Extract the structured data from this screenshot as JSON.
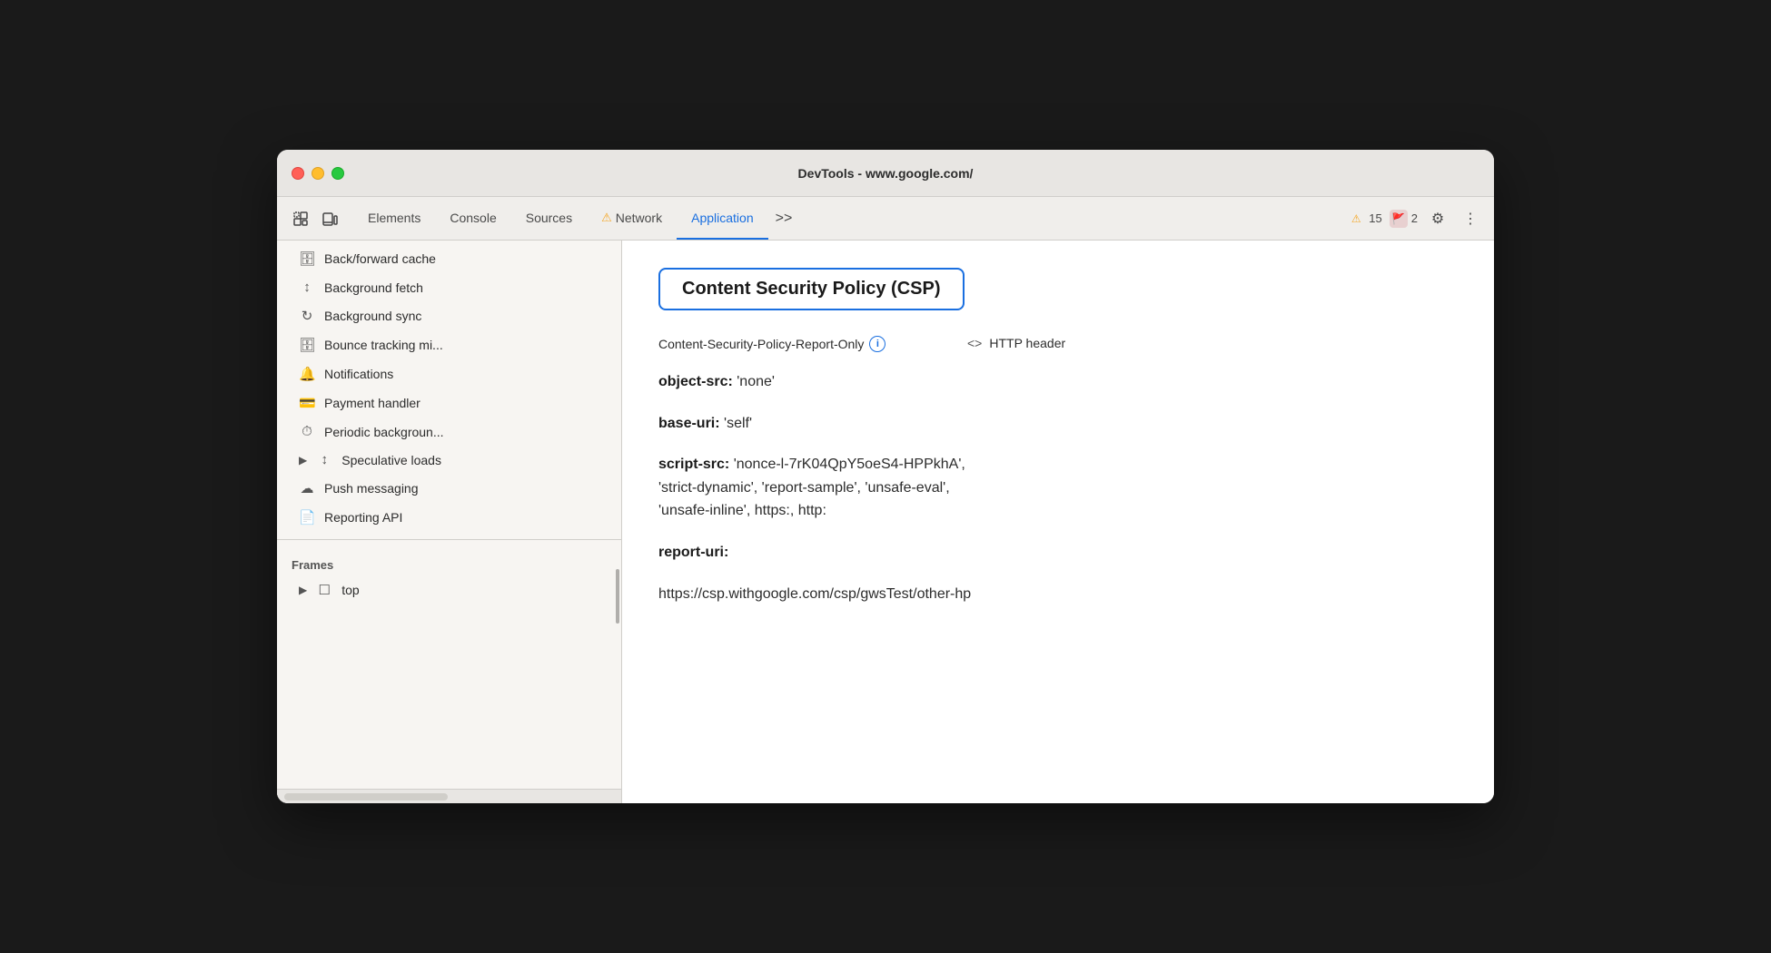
{
  "window": {
    "title": "DevTools - www.google.com/"
  },
  "titlebar": {
    "title": "DevTools - www.google.com/"
  },
  "tabs": [
    {
      "id": "elements",
      "label": "Elements",
      "active": false,
      "warning": false
    },
    {
      "id": "console",
      "label": "Console",
      "active": false,
      "warning": false
    },
    {
      "id": "sources",
      "label": "Sources",
      "active": false,
      "warning": false
    },
    {
      "id": "network",
      "label": "Network",
      "active": false,
      "warning": true
    },
    {
      "id": "application",
      "label": "Application",
      "active": true,
      "warning": false
    }
  ],
  "toolbar": {
    "more_label": ">>",
    "warnings_count": "15",
    "errors_count": "2"
  },
  "sidebar": {
    "items": [
      {
        "id": "back-forward-cache",
        "icon": "🗄",
        "label": "Back/forward cache"
      },
      {
        "id": "background-fetch",
        "icon": "↕",
        "label": "Background fetch"
      },
      {
        "id": "background-sync",
        "icon": "↻",
        "label": "Background sync"
      },
      {
        "id": "bounce-tracking",
        "icon": "🗄",
        "label": "Bounce tracking mi..."
      },
      {
        "id": "notifications",
        "icon": "🔔",
        "label": "Notifications"
      },
      {
        "id": "payment-handler",
        "icon": "💳",
        "label": "Payment handler"
      },
      {
        "id": "periodic-background",
        "icon": "⏱",
        "label": "Periodic backgroun..."
      },
      {
        "id": "speculative-loads",
        "icon": "↕",
        "label": "Speculative loads",
        "expandable": true
      },
      {
        "id": "push-messaging",
        "icon": "☁",
        "label": "Push messaging"
      },
      {
        "id": "reporting-api",
        "icon": "📄",
        "label": "Reporting API"
      }
    ],
    "frames_section": "Frames",
    "frames_item": "top"
  },
  "content": {
    "csp_title": "Content Security Policy (CSP)",
    "csp_label": "Content-Security-Policy-Report-Only",
    "csp_source": "HTTP header",
    "props": [
      {
        "key": "object-src:",
        "value": " 'none'"
      },
      {
        "key": "base-uri:",
        "value": " 'self'"
      },
      {
        "key": "script-src:",
        "value": " 'nonce-l-7rK04QpY5oeS4-HPPkhA',\n'strict-dynamic', 'report-sample', 'unsafe-eval',\n'unsafe-inline', https:, http:"
      },
      {
        "key": "report-uri:",
        "value": ""
      },
      {
        "key": "report_uri_val",
        "value": "https://csp.withgoogle.com/csp/gwsTest/other-hp"
      }
    ]
  }
}
